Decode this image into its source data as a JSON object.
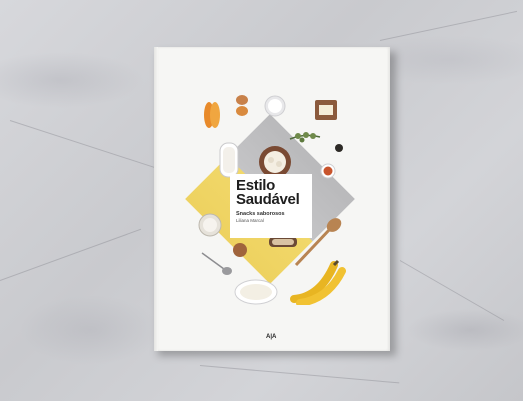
{
  "book": {
    "title_line1": "Estilo",
    "title_line2": "Saudável",
    "subtitle": "Snacks saborosos",
    "author": "Liliana Marcal",
    "publisher_logo": "A|A"
  },
  "colors": {
    "diamond_top": "#bfbfc1",
    "diamond_bottom": "#f0d565",
    "cover": "#f6f6f4"
  },
  "food_items": [
    "papaya-slices",
    "egg",
    "milk-glass",
    "butter-dish",
    "herb-sprig",
    "bread-bowl",
    "oat-bowl",
    "cup",
    "spoon",
    "wooden-spoon",
    "cream-bowl",
    "bananas",
    "small-bowl"
  ]
}
